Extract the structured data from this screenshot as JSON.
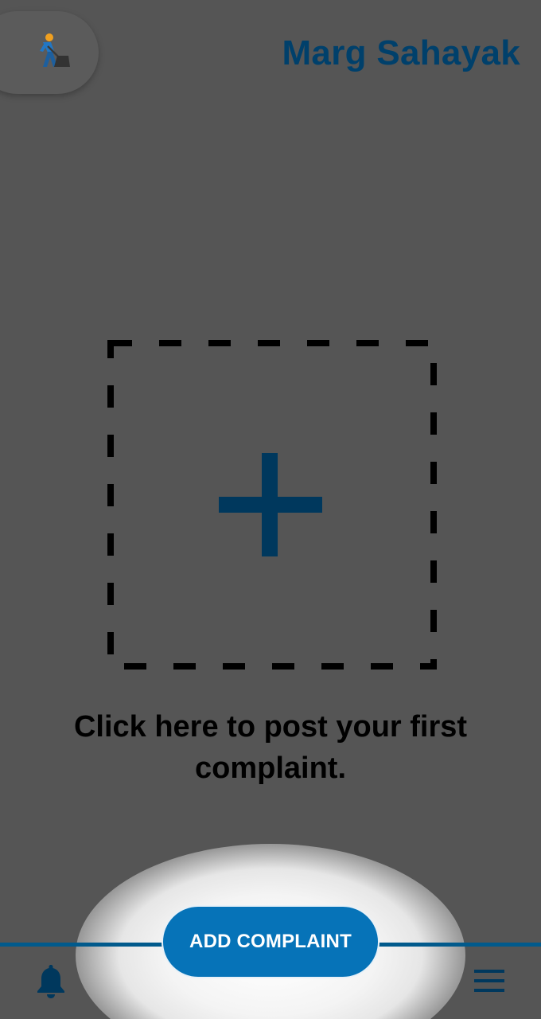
{
  "header": {
    "app_title": "Marg Sahayak",
    "logo_icon": "road-worker-icon"
  },
  "main": {
    "upload_icon": "plus-icon",
    "prompt": "Click here to post your first complaint."
  },
  "bottom_bar": {
    "add_button_label": "ADD COMPLAINT",
    "left_icon": "bell-icon",
    "right_icon": "hamburger-menu-icon"
  },
  "colors": {
    "background": "#555555",
    "title": "#00406b",
    "plus": "#00385d",
    "button": "#0673b8",
    "bar_line": "#015a8c"
  }
}
